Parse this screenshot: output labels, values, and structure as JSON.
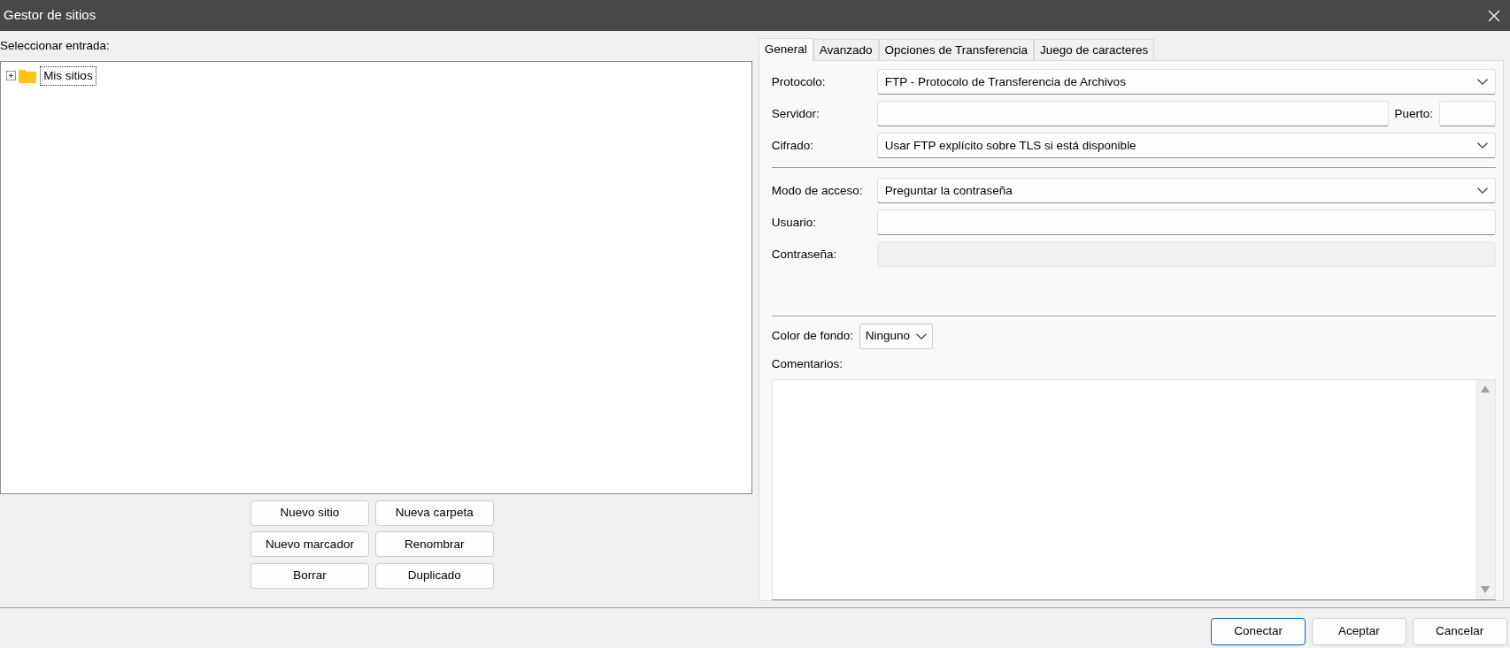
{
  "window": {
    "title": "Gestor de sitios"
  },
  "entries": {
    "label": "Seleccionar entrada:",
    "tree": [
      {
        "label": "Mis sitios",
        "expanded": false,
        "selected": true
      }
    ],
    "buttons": [
      [
        "Nuevo sitio",
        "Nueva carpeta"
      ],
      [
        "Nuevo marcador",
        "Renombrar"
      ],
      [
        "Borrar",
        "Duplicado"
      ]
    ]
  },
  "tabs": [
    {
      "label": "General",
      "selected": true
    },
    {
      "label": "Avanzado",
      "selected": false
    },
    {
      "label": "Opciones de Transferencia",
      "selected": false
    },
    {
      "label": "Juego de caracteres",
      "selected": false
    }
  ],
  "groups": [
    [
      {
        "label": "Protocolo:",
        "kind": "select",
        "value": "FTP - Protocolo de Transferencia de Archivos"
      },
      {
        "label": "Servidor:",
        "kind": "text",
        "port_label": "Puerto:"
      },
      {
        "label": "Cifrado:",
        "kind": "select",
        "value": "Usar FTP explícito sobre TLS si está disponible"
      }
    ],
    [
      {
        "label": "Modo de acceso:",
        "kind": "select",
        "value": "Preguntar la contraseña"
      },
      {
        "label": "Usuario:",
        "kind": "text"
      },
      {
        "label": "Contraseña:",
        "kind": "text",
        "disabled": true
      }
    ]
  ],
  "background": {
    "label": "Color de fondo:",
    "value": "Ninguno"
  },
  "comments": {
    "label": "Comentarios:"
  },
  "footer_buttons": [
    {
      "label": "Conectar",
      "default": true
    },
    {
      "label": "Aceptar",
      "default": false
    },
    {
      "label": "Cancelar",
      "default": false
    }
  ]
}
